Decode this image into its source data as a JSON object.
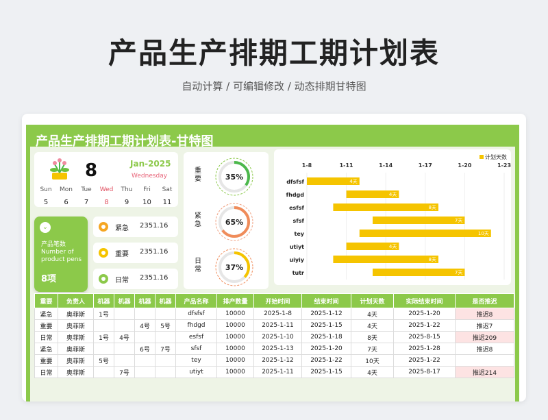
{
  "header": {
    "title": "产品生产排期工期计划表",
    "subtitle": "自动计算 /  可编辑修改  / 动态排期甘特图"
  },
  "sheet": {
    "title": "产品生产排期工期计划表-甘特图"
  },
  "calendar": {
    "day": "8",
    "month": "Jan-2025",
    "weekday": "Wednesday",
    "week": [
      {
        "name": "Sun",
        "date": "5"
      },
      {
        "name": "Mon",
        "date": "6"
      },
      {
        "name": "Tue",
        "date": "7"
      },
      {
        "name": "Wed",
        "date": "8"
      },
      {
        "name": "Thu",
        "date": "9"
      },
      {
        "name": "Fri",
        "date": "10"
      },
      {
        "name": "Sat",
        "date": "11"
      }
    ],
    "highlight_index": 3
  },
  "summary": {
    "label_cn": "产品笔数",
    "label_en": "Number of product pens",
    "value": "8项"
  },
  "priorities": [
    {
      "label": "紧急",
      "value": "2351.16",
      "color": "#f5a623",
      "icon": "flash-icon"
    },
    {
      "label": "重要",
      "value": "2351.16",
      "color": "#f5c400",
      "icon": "star-icon"
    },
    {
      "label": "日常",
      "value": "2351.16",
      "color": "#8cc94a",
      "icon": "leaf-icon"
    }
  ],
  "gauges": [
    {
      "label": "重要",
      "percent": 35,
      "value_text": "35%",
      "color": "#4cb84c",
      "dash": "#8cc94a"
    },
    {
      "label": "紧急",
      "percent": 65,
      "value_text": "65%",
      "color": "#f08c5a",
      "dash": "#f0a080"
    },
    {
      "label": "日常",
      "percent": 37,
      "value_text": "37%",
      "color": "#f5c400",
      "dash": "#f08c5a"
    }
  ],
  "chart_data": {
    "type": "bar",
    "orientation": "horizontal-gantt",
    "legend": [
      "计划天数"
    ],
    "legend_position": "top-right",
    "x_ticks": [
      "1-8",
      "1-11",
      "1-14",
      "1-17",
      "1-20",
      "1-23"
    ],
    "xlim": [
      "2025-01-08",
      "2025-01-23"
    ],
    "grid": true,
    "series": [
      {
        "name": "计划天数",
        "color": "#f5c400",
        "tasks": [
          {
            "label": "dfsfsf",
            "start": "2025-01-08",
            "days": 4,
            "text": "4天"
          },
          {
            "label": "fhdgd",
            "start": "2025-01-11",
            "days": 4,
            "text": "4天"
          },
          {
            "label": "esfsf",
            "start": "2025-01-10",
            "days": 8,
            "text": "8天"
          },
          {
            "label": "sfsf",
            "start": "2025-01-13",
            "days": 7,
            "text": "7天"
          },
          {
            "label": "tey",
            "start": "2025-01-12",
            "days": 10,
            "text": "10天"
          },
          {
            "label": "utiyt",
            "start": "2025-01-11",
            "days": 4,
            "text": "4天"
          },
          {
            "label": "uiyiy",
            "start": "2025-01-10",
            "days": 8,
            "text": "8天"
          },
          {
            "label": "tutr",
            "start": "2025-01-13",
            "days": 7,
            "text": "7天"
          }
        ]
      }
    ]
  },
  "table": {
    "headers": [
      "重要",
      "负责人",
      "机器",
      "机器",
      "机器",
      "机器",
      "产品名称",
      "排产数量",
      "开始时间",
      "结束时间",
      "计划天数",
      "实际结束时间",
      "是否推迟"
    ],
    "rows": [
      [
        "紧急",
        "奥菲斯",
        "1号",
        "",
        "",
        "",
        "dfsfsf",
        "10000",
        "2025-1-8",
        "2025-1-12",
        "4天",
        "2025-1-20",
        "推迟8"
      ],
      [
        "重要",
        "奥菲斯",
        "",
        "",
        "4号",
        "5号",
        "fhdgd",
        "10000",
        "2025-1-11",
        "2025-1-15",
        "4天",
        "2025-1-22",
        "推迟7"
      ],
      [
        "日常",
        "奥菲斯",
        "1号",
        "4号",
        "",
        "",
        "esfsf",
        "10000",
        "2025-1-10",
        "2025-1-18",
        "8天",
        "2025-8-15",
        "推迟209"
      ],
      [
        "紧急",
        "奥菲斯",
        "",
        "",
        "6号",
        "7号",
        "sfsf",
        "10000",
        "2025-1-13",
        "2025-1-20",
        "7天",
        "2025-1-28",
        "推迟8"
      ],
      [
        "重要",
        "奥菲斯",
        "5号",
        "",
        "",
        "",
        "tey",
        "10000",
        "2025-1-12",
        "2025-1-22",
        "10天",
        "2025-1-22",
        ""
      ],
      [
        "日常",
        "奥菲斯",
        "",
        "7号",
        "",
        "",
        "utiyt",
        "10000",
        "2025-1-11",
        "2025-1-15",
        "4天",
        "2025-8-17",
        "推迟214"
      ]
    ],
    "late_highlight": [
      true,
      false,
      true,
      false,
      false,
      true
    ]
  }
}
